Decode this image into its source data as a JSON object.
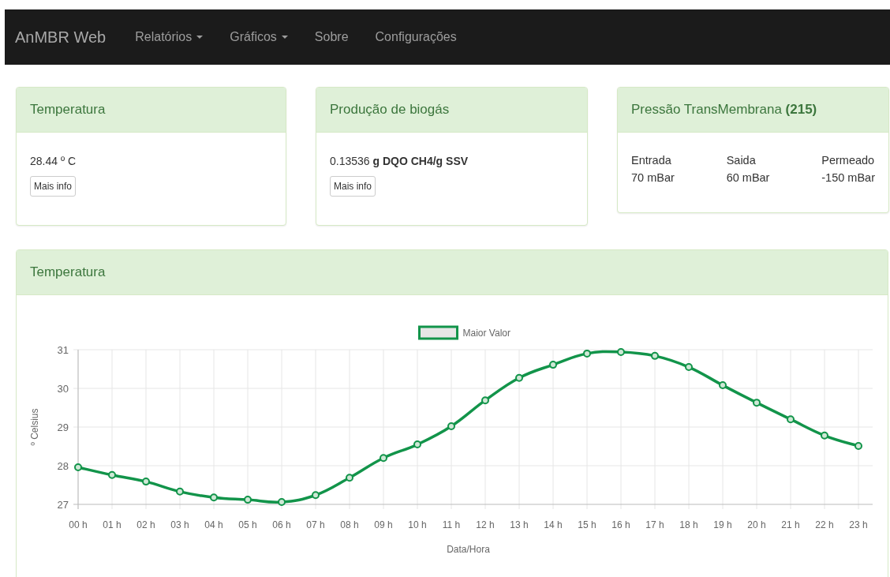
{
  "navbar": {
    "brand": "AnMBR Web",
    "items": [
      {
        "label": "Relatórios",
        "dropdown": true
      },
      {
        "label": "Gráficos",
        "dropdown": true
      },
      {
        "label": "Sobre",
        "dropdown": false
      },
      {
        "label": "Configurações",
        "dropdown": false
      }
    ]
  },
  "cards": [
    {
      "kind": "value",
      "title": "Temperatura",
      "value": "28.44 º C",
      "button": "Mais info"
    },
    {
      "kind": "value",
      "title": "Produção de biogás",
      "value": "0.13536 **g DQO CH4/g SSV**",
      "button": "Mais info"
    },
    {
      "kind": "pressure",
      "title": "Pressão TransMembrana **(215)**",
      "columns": [
        {
          "label": "Entrada",
          "value": "70 mBar"
        },
        {
          "label": "Saida",
          "value": "60 mBar"
        },
        {
          "label": "Permeado",
          "value": "-150 mBar"
        }
      ]
    }
  ],
  "chart": {
    "title": "Temperatura",
    "chart_data": {
      "type": "line",
      "xlabel": "Data/Hora",
      "ylabel": "º Celsius",
      "categories": [
        "00 h",
        "01 h",
        "02 h",
        "03 h",
        "04 h",
        "05 h",
        "06 h",
        "07 h",
        "08 h",
        "09 h",
        "10 h",
        "11 h",
        "12 h",
        "13 h",
        "14 h",
        "15 h",
        "16 h",
        "17 h",
        "18 h",
        "19 h",
        "20 h",
        "21 h",
        "22 h",
        "23 h"
      ],
      "series": [
        {
          "name": "Maior Valor",
          "color": "#12944a",
          "marker": "circle",
          "values": [
            27.96,
            27.76,
            27.59,
            27.33,
            27.18,
            27.12,
            27.06,
            27.24,
            27.69,
            28.2,
            28.55,
            29.02,
            29.69,
            30.27,
            30.61,
            30.9,
            30.94,
            30.84,
            30.55,
            30.08,
            29.63,
            29.2,
            28.78,
            28.51
          ]
        }
      ],
      "ylim": [
        27,
        31
      ],
      "yticks": [
        27,
        28,
        29,
        30,
        31
      ],
      "grid": true
    }
  }
}
